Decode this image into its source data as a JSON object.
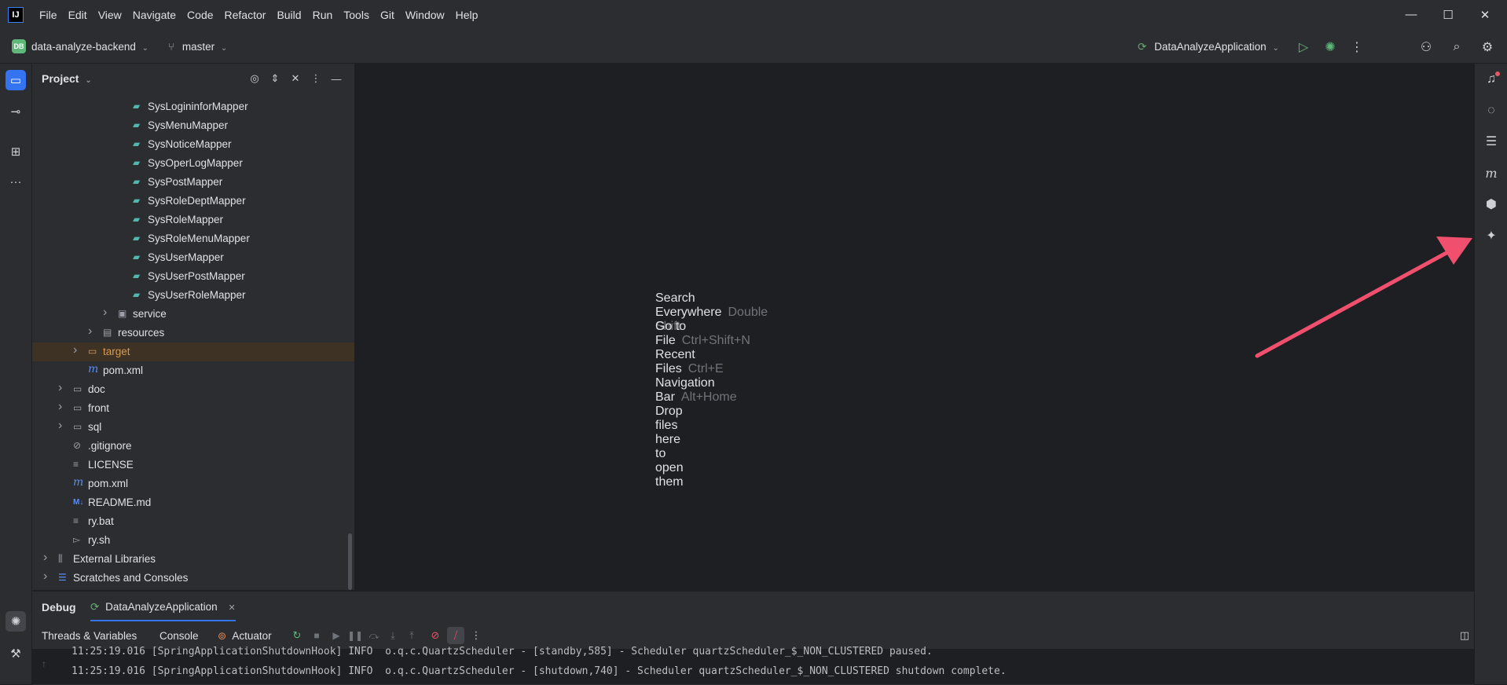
{
  "menubar": {
    "logo": "IJ",
    "items": [
      "File",
      "Edit",
      "View",
      "Navigate",
      "Code",
      "Refactor",
      "Build",
      "Run",
      "Tools",
      "Git",
      "Window",
      "Help"
    ],
    "minimize": "—",
    "maximize": "☐",
    "close": "✕"
  },
  "toolbar": {
    "project_badge": "DB",
    "project_name": "data-analyze-backend",
    "branch": "master",
    "run_config": "DataAnalyzeApplication",
    "icons": [
      "run-icon",
      "debug-icon",
      "more-icon",
      "add-user-icon",
      "search-icon",
      "settings-icon"
    ]
  },
  "project_panel": {
    "title": "Project",
    "tree": [
      {
        "label": "SysLogininforMapper",
        "depth": 4,
        "kind": "mapper"
      },
      {
        "label": "SysMenuMapper",
        "depth": 4,
        "kind": "mapper"
      },
      {
        "label": "SysNoticeMapper",
        "depth": 4,
        "kind": "mapper"
      },
      {
        "label": "SysOperLogMapper",
        "depth": 4,
        "kind": "mapper"
      },
      {
        "label": "SysPostMapper",
        "depth": 4,
        "kind": "mapper"
      },
      {
        "label": "SysRoleDeptMapper",
        "depth": 4,
        "kind": "mapper"
      },
      {
        "label": "SysRoleMapper",
        "depth": 4,
        "kind": "mapper"
      },
      {
        "label": "SysRoleMenuMapper",
        "depth": 4,
        "kind": "mapper"
      },
      {
        "label": "SysUserMapper",
        "depth": 4,
        "kind": "mapper"
      },
      {
        "label": "SysUserPostMapper",
        "depth": 4,
        "kind": "mapper"
      },
      {
        "label": "SysUserRoleMapper",
        "depth": 4,
        "kind": "mapper"
      },
      {
        "label": "service",
        "depth": 3,
        "kind": "pkg-folder",
        "arrow": true
      },
      {
        "label": "resources",
        "depth": 2,
        "kind": "res-folder",
        "arrow": true
      },
      {
        "label": "target",
        "depth": 1,
        "kind": "folder",
        "arrow": true,
        "highlight": true
      },
      {
        "label": "pom.xml",
        "depth": 1,
        "kind": "maven"
      },
      {
        "label": "doc",
        "depth": 0,
        "kind": "folder",
        "arrow": true
      },
      {
        "label": "front",
        "depth": 0,
        "kind": "folder",
        "arrow": true
      },
      {
        "label": "sql",
        "depth": 0,
        "kind": "folder",
        "arrow": true
      },
      {
        "label": ".gitignore",
        "depth": 0,
        "kind": "ignore"
      },
      {
        "label": "LICENSE",
        "depth": 0,
        "kind": "text"
      },
      {
        "label": "pom.xml",
        "depth": 0,
        "kind": "maven"
      },
      {
        "label": "README.md",
        "depth": 0,
        "kind": "markdown"
      },
      {
        "label": "ry.bat",
        "depth": 0,
        "kind": "text"
      },
      {
        "label": "ry.sh",
        "depth": 0,
        "kind": "shell"
      },
      {
        "label": "External Libraries",
        "depth": -1,
        "kind": "library",
        "arrow": true
      },
      {
        "label": "Scratches and Consoles",
        "depth": -1,
        "kind": "scratch",
        "arrow": true
      }
    ]
  },
  "editor": {
    "hints": [
      {
        "label": "Search Everywhere",
        "key": "Double Shift"
      },
      {
        "label": "Go to File",
        "key": "Ctrl+Shift+N"
      },
      {
        "label": "Recent Files",
        "key": "Ctrl+E"
      },
      {
        "label": "Navigation Bar",
        "key": "Alt+Home"
      },
      {
        "label": "Drop files here to open them",
        "key": ""
      }
    ]
  },
  "debug": {
    "title": "Debug",
    "session_tab": "DataAnalyzeApplication",
    "subtabs": [
      "Threads & Variables",
      "Console",
      "Actuator"
    ],
    "log_lines": [
      "11:25:19.016 [SpringApplicationShutdownHook] INFO  o.q.c.QuartzScheduler - [standby,585] - Scheduler quartzScheduler_$_NON_CLUSTERED paused.",
      "11:25:19.016 [SpringApplicationShutdownHook] INFO  o.q.c.QuartzScheduler - [shutdown,740] - Scheduler quartzScheduler_$_NON_CLUSTERED shutdown complete."
    ]
  },
  "colors": {
    "accent": "#3574f0",
    "annotation_arrow": "#f0506e",
    "highlight_folder": "#d69a56"
  }
}
